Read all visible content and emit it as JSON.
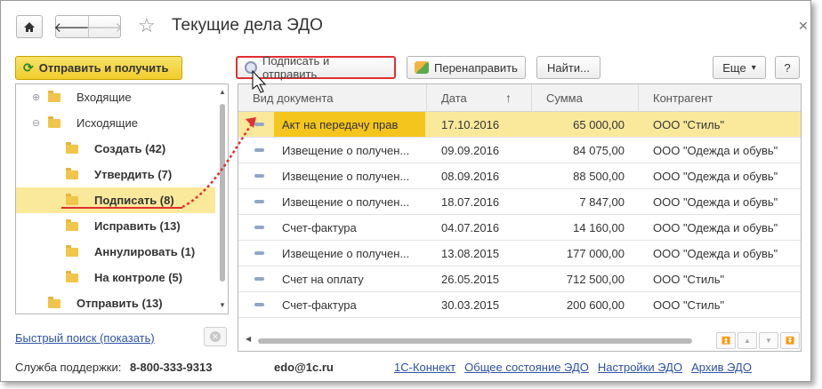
{
  "window": {
    "title": "Текущие дела ЭДО",
    "icons": {
      "home": "home-icon",
      "back": "arrow-left-icon",
      "forward": "arrow-right-icon",
      "favorite": "star-icon",
      "close": "close-icon"
    }
  },
  "left_panel": {
    "send_receive_label": "Отправить и получить",
    "tree": [
      {
        "label": "Входящие",
        "level": 0,
        "expander": "⊕",
        "bold": false,
        "selected": false
      },
      {
        "label": "Исходящие",
        "level": 0,
        "expander": "⊖",
        "bold": false,
        "selected": false
      },
      {
        "label": "Создать (42)",
        "level": 1,
        "bold": true,
        "selected": false
      },
      {
        "label": "Утвердить (7)",
        "level": 1,
        "bold": true,
        "selected": false
      },
      {
        "label": "Подписать (8)",
        "level": 1,
        "bold": true,
        "selected": true
      },
      {
        "label": "Исправить (13)",
        "level": 1,
        "bold": true,
        "selected": false
      },
      {
        "label": "Аннулировать (1)",
        "level": 1,
        "bold": true,
        "selected": false
      },
      {
        "label": "На контроле (5)",
        "level": 1,
        "bold": true,
        "selected": false
      },
      {
        "label": "Отправить (13)",
        "level": 0,
        "bold": true,
        "selected": false
      }
    ],
    "quick_search_label": "Быстрый поиск (показать)"
  },
  "toolbar": {
    "sign_and_send_label": "Подписать и отправить",
    "redirect_label": "Перенаправить",
    "find_label": "Найти...",
    "more_label": "Еще",
    "more_chevron": "▾",
    "help_label": "?"
  },
  "grid": {
    "columns": [
      "Вид документа",
      "Дата",
      "Сумма",
      "Контрагент"
    ],
    "sort_indicator": "↑",
    "rows": [
      {
        "name": "Акт на передачу прав",
        "date": "17.10.2016",
        "sum": "65 000,00",
        "agent": "ООО \"Стиль\"",
        "selected": true
      },
      {
        "name": "Извещение о получен...",
        "date": "09.09.2016",
        "sum": "84 075,00",
        "agent": "ООО \"Одежда и обувь\"",
        "selected": false
      },
      {
        "name": "Извещение о получен...",
        "date": "08.09.2016",
        "sum": "88 500,00",
        "agent": "ООО \"Одежда и обувь\"",
        "selected": false
      },
      {
        "name": "Извещение о получен...",
        "date": "18.07.2016",
        "sum": "7 847,00",
        "agent": "ООО \"Одежда и обувь\"",
        "selected": false
      },
      {
        "name": "Счет-фактура",
        "date": "04.07.2016",
        "sum": "14 160,00",
        "agent": "ООО \"Одежда и обувь\"",
        "selected": false
      },
      {
        "name": "Извещение о получен...",
        "date": "13.08.2015",
        "sum": "177 000,00",
        "agent": "ООО \"Одежда и обувь\"",
        "selected": false
      },
      {
        "name": "Счет на оплату",
        "date": "26.05.2015",
        "sum": "712 500,00",
        "agent": "ООО \"Стиль\"",
        "selected": false
      },
      {
        "name": "Счет-фактура",
        "date": "30.03.2015",
        "sum": "200 600,00",
        "agent": "ООО \"Стиль\"",
        "selected": false
      }
    ]
  },
  "footer": {
    "support_label": "Служба поддержки:",
    "support_phone": "8-800-333-9313",
    "email": "edo@1c.ru",
    "links": [
      "1С-Коннект",
      "Общее состояние ЭДО",
      "Настройки ЭДО",
      "Архив ЭДО"
    ]
  },
  "colors": {
    "accent_yellow": "#f1cd2b",
    "selection": "#fbe99b",
    "annotation_red": "#e03030",
    "link_blue": "#2d52a5"
  }
}
